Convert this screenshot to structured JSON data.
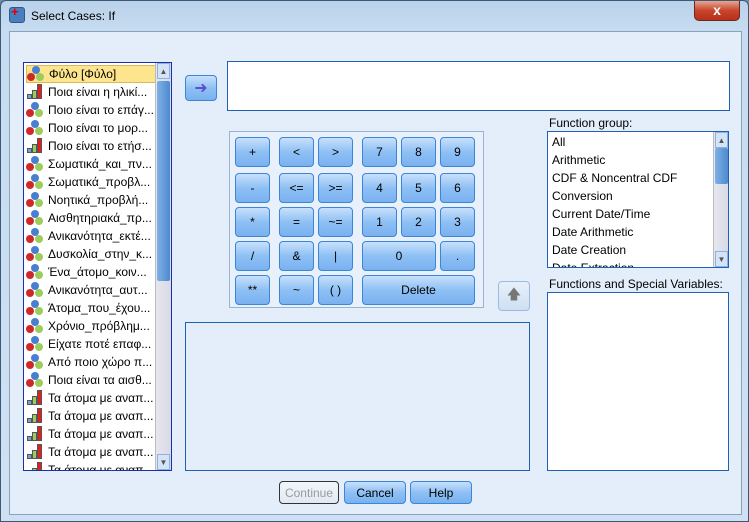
{
  "window": {
    "title": "Select Cases: If",
    "close_label": "x"
  },
  "variables": [
    {
      "label": "Φύλο [Φύλο]",
      "type": "nominal",
      "selected": true
    },
    {
      "label": "Ποια είναι η ηλικί...",
      "type": "scale"
    },
    {
      "label": "Ποιο είναι το επάγ...",
      "type": "nominal"
    },
    {
      "label": "Ποιο είναι το μορ...",
      "type": "nominal"
    },
    {
      "label": "Ποιο είναι το ετήσ...",
      "type": "scale"
    },
    {
      "label": "Σωματικά_και_πν...",
      "type": "nominal"
    },
    {
      "label": "Σωματικά_προβλ...",
      "type": "nominal"
    },
    {
      "label": "Νοητικά_προβλή...",
      "type": "nominal"
    },
    {
      "label": "Αισθητηριακά_πρ...",
      "type": "nominal"
    },
    {
      "label": "Ανικανότητα_εκτέ...",
      "type": "nominal"
    },
    {
      "label": "Δυσκολία_στην_κ...",
      "type": "nominal"
    },
    {
      "label": "Ένα_άτομο_κοιν...",
      "type": "nominal"
    },
    {
      "label": "Ανικανότητα_αυτ...",
      "type": "nominal"
    },
    {
      "label": "Άτομα_που_έχου...",
      "type": "nominal"
    },
    {
      "label": "Χρόνιο_πρόβλημ...",
      "type": "nominal"
    },
    {
      "label": "Είχατε ποτέ επαφ...",
      "type": "nominal"
    },
    {
      "label": "Από ποιο χώρο π...",
      "type": "nominal"
    },
    {
      "label": "Ποια είναι τα αισθ...",
      "type": "nominal"
    },
    {
      "label": "Τα άτομα με αναπ...",
      "type": "scale"
    },
    {
      "label": "Τα άτομα με αναπ...",
      "type": "scale"
    },
    {
      "label": "Τα άτομα με αναπ...",
      "type": "scale"
    },
    {
      "label": "Τα άτομα με αναπ...",
      "type": "scale"
    },
    {
      "label": "Τα άτομα με αναπ...",
      "type": "scale"
    }
  ],
  "keypad": [
    {
      "label": "+",
      "col": 0,
      "row": 0
    },
    {
      "label": "<",
      "col": 1,
      "row": 0
    },
    {
      "label": ">",
      "col": 2,
      "row": 0
    },
    {
      "label": "7",
      "col": 3,
      "row": 0
    },
    {
      "label": "8",
      "col": 4,
      "row": 0
    },
    {
      "label": "9",
      "col": 5,
      "row": 0
    },
    {
      "label": "-",
      "col": 0,
      "row": 1
    },
    {
      "label": "<=",
      "col": 1,
      "row": 1
    },
    {
      "label": ">=",
      "col": 2,
      "row": 1
    },
    {
      "label": "4",
      "col": 3,
      "row": 1
    },
    {
      "label": "5",
      "col": 4,
      "row": 1
    },
    {
      "label": "6",
      "col": 5,
      "row": 1
    },
    {
      "label": "*",
      "col": 0,
      "row": 2
    },
    {
      "label": "=",
      "col": 1,
      "row": 2
    },
    {
      "label": "~=",
      "col": 2,
      "row": 2
    },
    {
      "label": "1",
      "col": 3,
      "row": 2
    },
    {
      "label": "2",
      "col": 4,
      "row": 2
    },
    {
      "label": "3",
      "col": 5,
      "row": 2
    },
    {
      "label": "/",
      "col": 0,
      "row": 3
    },
    {
      "label": "&",
      "col": 1,
      "row": 3
    },
    {
      "label": "|",
      "col": 2,
      "row": 3
    },
    {
      "label": "0",
      "col": 3,
      "row": 3,
      "span": 2
    },
    {
      "label": ".",
      "col": 5,
      "row": 3
    },
    {
      "label": "**",
      "col": 0,
      "row": 4
    },
    {
      "label": "~",
      "col": 1,
      "row": 4
    },
    {
      "label": "( )",
      "col": 2,
      "row": 4
    },
    {
      "label": "Delete",
      "col": 3,
      "row": 4,
      "span": 3
    }
  ],
  "function_group": {
    "label": "Function group:",
    "items": [
      "All",
      "Arithmetic",
      "CDF & Noncentral CDF",
      "Conversion",
      "Current Date/Time",
      "Date Arithmetic",
      "Date Creation",
      "Date Extraction"
    ]
  },
  "functions_label": "Functions and Special Variables:",
  "expression": "",
  "buttons": {
    "continue": "Continue",
    "cancel": "Cancel",
    "help": "Help"
  }
}
